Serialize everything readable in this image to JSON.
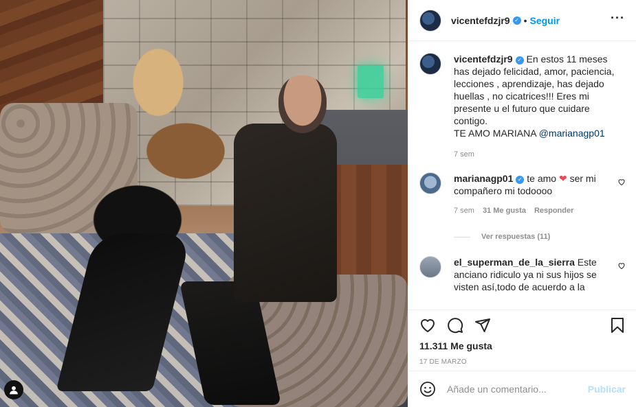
{
  "post": {
    "author": "vicentefdzjr9",
    "follow_label": "Seguir",
    "more_icon": "more-horizontal-icon",
    "dot": "•"
  },
  "caption": {
    "author": "vicentefdzjr9",
    "text": "En estos 11 meses has dejado felicidad, amor, paciencia, lecciones , aprendizaje, has dejado huellas , no cicatrices!!! Eres mi presente u el futuro que cuidare contigo.",
    "text2": "TE AMO MARIANA",
    "mention": "@marianagp01",
    "time": "7 sem"
  },
  "comments": [
    {
      "author": "marianagp01",
      "text_before": "te amo",
      "heart": "❤",
      "text_after": "ser mi compañero mi todoooo",
      "time": "7 sem",
      "likes": "31 Me gusta",
      "reply": "Responder",
      "view_replies": "Ver respuestas (11)"
    },
    {
      "author": "el_superman_de_la_sierra",
      "text": "Este anciano ridiculo ya ni sus hijos se visten así,todo de acuerdo a la"
    }
  ],
  "actions": {
    "like_icon": "heart-icon",
    "comment_icon": "comment-icon",
    "share_icon": "paper-plane-icon",
    "save_icon": "bookmark-icon"
  },
  "likes_label": "11.311 Me gusta",
  "date": "17 DE MARZO",
  "add_comment": {
    "placeholder": "Añade un comentario...",
    "post_label": "Publicar",
    "emoji_icon": "smile-icon"
  },
  "colors": {
    "accent": "#0095f6",
    "verified": "#3897f0",
    "heart": "#ed4956",
    "muted": "#8e8e8e"
  }
}
